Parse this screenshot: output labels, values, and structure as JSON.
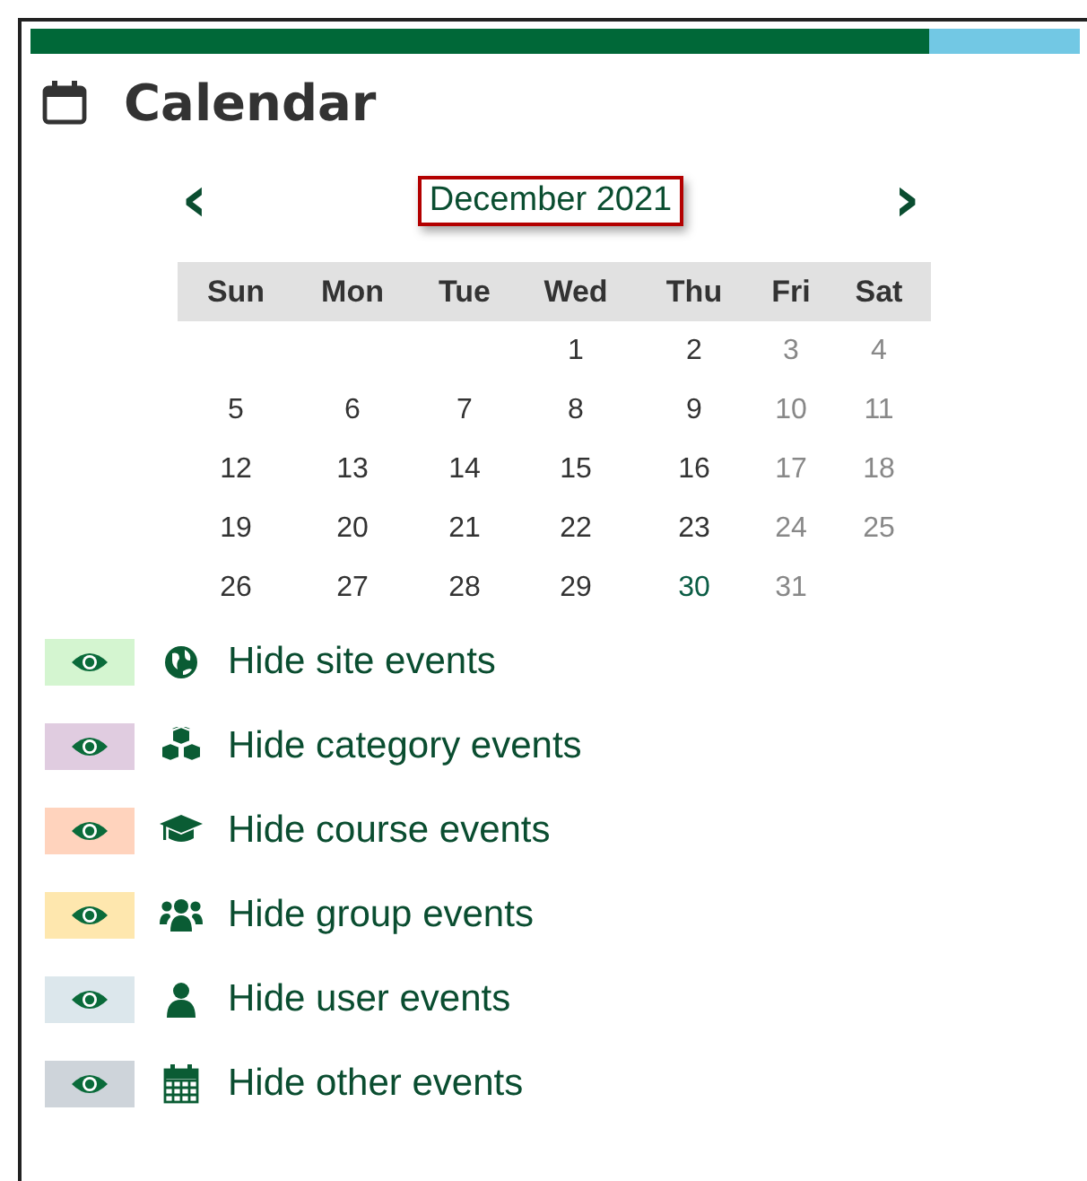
{
  "block": {
    "title": "Calendar"
  },
  "nav": {
    "prev": "‹",
    "month": "December 2021",
    "next": "›"
  },
  "weekdays": [
    "Sun",
    "Mon",
    "Tue",
    "Wed",
    "Thu",
    "Fri",
    "Sat"
  ],
  "weeks": [
    {
      "kind": "first",
      "days": [
        {
          "day": "1",
          "weekend": false,
          "today": false
        },
        {
          "day": "2",
          "weekend": false,
          "today": false
        },
        {
          "day": "3",
          "weekend": true,
          "today": false
        },
        {
          "day": "4",
          "weekend": true,
          "today": false
        }
      ]
    },
    {
      "kind": "full",
      "days": [
        {
          "day": "5",
          "weekend": false,
          "today": false
        },
        {
          "day": "6",
          "weekend": false,
          "today": false
        },
        {
          "day": "7",
          "weekend": false,
          "today": false
        },
        {
          "day": "8",
          "weekend": false,
          "today": false
        },
        {
          "day": "9",
          "weekend": false,
          "today": false
        },
        {
          "day": "10",
          "weekend": true,
          "today": false
        },
        {
          "day": "11",
          "weekend": true,
          "today": false
        }
      ]
    },
    {
      "kind": "full",
      "days": [
        {
          "day": "12",
          "weekend": false,
          "today": false
        },
        {
          "day": "13",
          "weekend": false,
          "today": false
        },
        {
          "day": "14",
          "weekend": false,
          "today": false
        },
        {
          "day": "15",
          "weekend": false,
          "today": false
        },
        {
          "day": "16",
          "weekend": false,
          "today": false
        },
        {
          "day": "17",
          "weekend": true,
          "today": false
        },
        {
          "day": "18",
          "weekend": true,
          "today": false
        }
      ]
    },
    {
      "kind": "full",
      "days": [
        {
          "day": "19",
          "weekend": false,
          "today": false
        },
        {
          "day": "20",
          "weekend": false,
          "today": false
        },
        {
          "day": "21",
          "weekend": false,
          "today": false
        },
        {
          "day": "22",
          "weekend": false,
          "today": false
        },
        {
          "day": "23",
          "weekend": false,
          "today": false
        },
        {
          "day": "24",
          "weekend": true,
          "today": false
        },
        {
          "day": "25",
          "weekend": true,
          "today": false
        }
      ]
    },
    {
      "kind": "last",
      "days": [
        {
          "day": "26",
          "weekend": false,
          "today": false
        },
        {
          "day": "27",
          "weekend": false,
          "today": false
        },
        {
          "day": "28",
          "weekend": false,
          "today": false
        },
        {
          "day": "29",
          "weekend": false,
          "today": false
        },
        {
          "day": "30",
          "weekend": false,
          "today": true
        },
        {
          "day": "31",
          "weekend": true,
          "today": false
        }
      ]
    }
  ],
  "filters": [
    {
      "kind": "site",
      "label": "Hide site events",
      "color": "#d4f5d0"
    },
    {
      "kind": "category",
      "label": "Hide category events",
      "color": "#e0cce0"
    },
    {
      "kind": "course",
      "label": "Hide course events",
      "color": "#ffd3bd"
    },
    {
      "kind": "group",
      "label": "Hide group events",
      "color": "#fee7ae"
    },
    {
      "kind": "user",
      "label": "Hide user events",
      "color": "#dce7ec"
    },
    {
      "kind": "other",
      "label": "Hide other events",
      "color": "#ced4da"
    }
  ]
}
